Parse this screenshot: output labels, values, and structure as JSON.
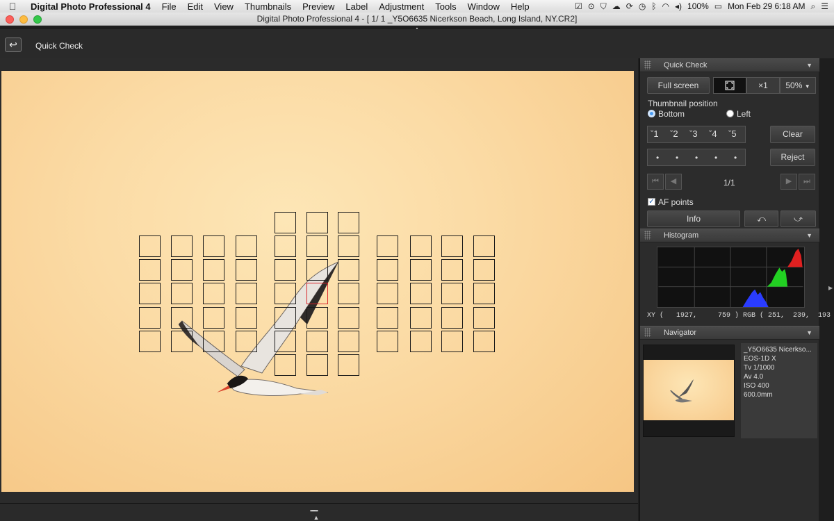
{
  "menubar": {
    "app_name": "Digital Photo Professional 4",
    "items": [
      "File",
      "Edit",
      "View",
      "Thumbnails",
      "Preview",
      "Label",
      "Adjustment",
      "Tools",
      "Window",
      "Help"
    ],
    "battery": "100%",
    "clock": "Mon Feb 29  6:18 AM"
  },
  "window": {
    "title": "Digital Photo Professional 4 - [   1/   1 _Y5O6635 Nicerkson Beach, Long Island, NY.CR2]"
  },
  "toolbar": {
    "back_icon": "↩",
    "title": "Quick Check"
  },
  "quick_check": {
    "header": "Quick Check",
    "full_screen_label": "Full screen",
    "x1_label": "×1",
    "zoom_value": "50%",
    "thumb_pos_label": "Thumbnail position",
    "bottom_label": "Bottom",
    "left_label": "Left",
    "ratings": [
      "1",
      "2",
      "3",
      "4",
      "5"
    ],
    "clear_label": "Clear",
    "reject_label": "Reject",
    "page_label": "1/1",
    "af_points_label": "AF points",
    "info_label": "Info"
  },
  "histogram": {
    "header": "Histogram",
    "xy_text": "XY (   1927,     759 ) RGB ( 251,  239,  193 )"
  },
  "navigator": {
    "header": "Navigator",
    "info": [
      "_Y5O6635 Nicerkso...",
      "EOS-1D X",
      "Tv 1/1000",
      "Av 4.0",
      "ISO 400",
      "600.0mm"
    ]
  }
}
